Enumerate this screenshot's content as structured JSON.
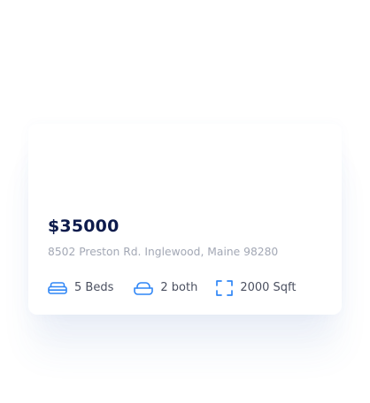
{
  "listing": {
    "price": "$35000",
    "address": "8502 Preston Rd. Inglewood, Maine 98280",
    "features": [
      {
        "icon": "bed-icon",
        "label": "5 Beds"
      },
      {
        "icon": "bathtub-icon",
        "label": "2 both"
      },
      {
        "icon": "area-icon",
        "label": "2000 Sqft"
      }
    ]
  },
  "colors": {
    "accent": "#2f86f6",
    "price": "#0d1b4c",
    "address": "#a3a8b5",
    "feature_text": "#4b5060"
  }
}
